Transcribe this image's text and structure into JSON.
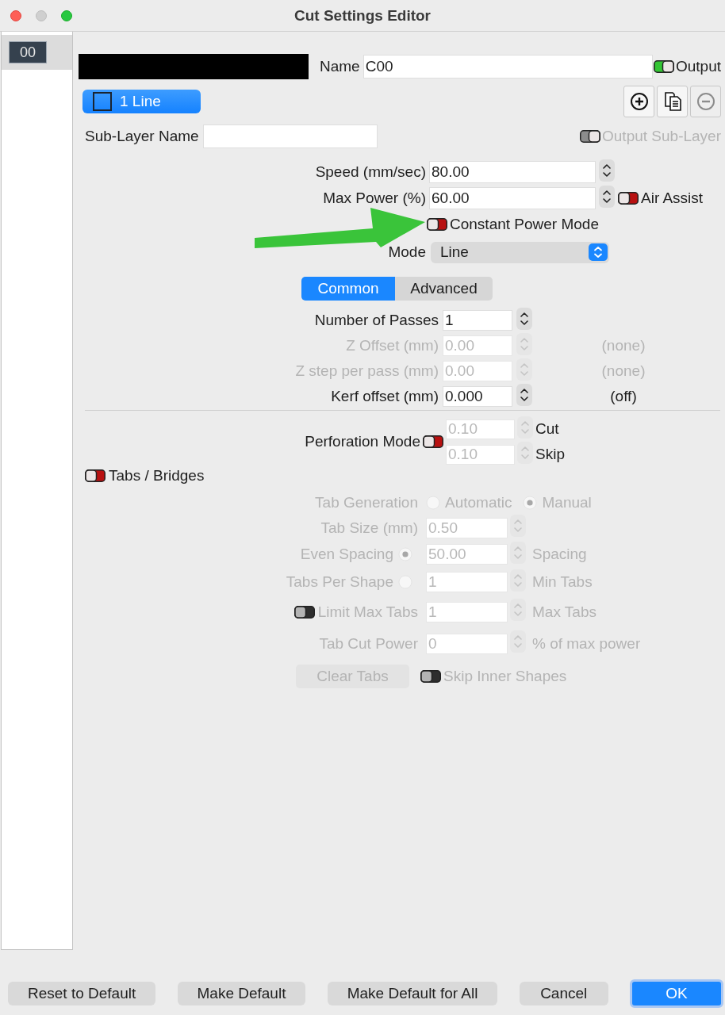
{
  "window": {
    "title": "Cut Settings Editor"
  },
  "layer_list": [
    {
      "label": "00",
      "selected": true
    }
  ],
  "name_row": {
    "label": "Name",
    "value": "C00",
    "output": {
      "label": "Output",
      "on": true,
      "disabled": false
    }
  },
  "sub_layers": [
    {
      "label": "1 Line",
      "selected": true
    }
  ],
  "sub_layer_actions": [
    {
      "kind": "add",
      "disabled": false
    },
    {
      "kind": "copy",
      "disabled": false
    },
    {
      "kind": "remove",
      "disabled": true
    }
  ],
  "sub_layer_name": {
    "label": "Sub-Layer Name"
  },
  "output_sub_layer": {
    "label": "Output Sub-Layer",
    "on": true,
    "disabled": true
  },
  "power_fields": [
    {
      "label": "Speed (mm/sec)",
      "value": "80.00"
    },
    {
      "label": "Max Power (%)",
      "value": "60.00"
    }
  ],
  "air_assist": {
    "label": "Air Assist",
    "on": false,
    "disabled": false
  },
  "constant_power_mode": {
    "label": "Constant Power Mode",
    "on": false,
    "disabled": false
  },
  "mode": {
    "label": "Mode",
    "value": "Line"
  },
  "tabs": [
    {
      "label": "Common",
      "selected": true
    },
    {
      "label": "Advanced",
      "selected": false
    }
  ],
  "common_fields": [
    {
      "label": "Number of Passes",
      "value": "1",
      "disabled": false
    },
    {
      "label": "Z Offset (mm)",
      "value": "0.00",
      "disabled": true,
      "note": "(none)"
    },
    {
      "label": "Z step per pass (mm)",
      "value": "0.00",
      "disabled": true,
      "note": "(none)"
    },
    {
      "label": "Kerf offset (mm)",
      "value": "0.000",
      "disabled": false,
      "note": "(off)"
    }
  ],
  "perforation": {
    "label": "Perforation Mode",
    "on": false,
    "disabled": false,
    "fields": [
      {
        "value": "0.10",
        "label": "Cut",
        "disabled": true
      },
      {
        "value": "0.10",
        "label": "Skip",
        "disabled": true
      }
    ]
  },
  "tabs_bridges": {
    "label": "Tabs / Bridges",
    "on": false,
    "disabled": false
  },
  "tab_generation": {
    "label": "Tab Generation",
    "disabled": true,
    "options": [
      {
        "label": "Automatic",
        "selected": false
      },
      {
        "label": "Manual",
        "selected": true
      }
    ]
  },
  "tab_fields": [
    {
      "kind": "field",
      "label": "Tab Size (mm)",
      "value": "0.50",
      "disabled": true
    },
    {
      "kind": "radio",
      "label": "Even Spacing",
      "selected": true,
      "value": "50.00",
      "suffix": "Spacing",
      "disabled": true
    },
    {
      "kind": "radio",
      "label": "Tabs Per Shape",
      "selected": false,
      "value": "1",
      "suffix": "Min Tabs",
      "disabled": true
    },
    {
      "kind": "toggle",
      "label": "Limit Max Tabs",
      "on": false,
      "value": "1",
      "suffix": "Max Tabs",
      "disabled": true
    },
    {
      "kind": "field",
      "label": "Tab Cut Power",
      "value": "0",
      "suffix": "% of max power",
      "disabled": true
    }
  ],
  "clear_tabs": {
    "label": "Clear Tabs",
    "disabled": true
  },
  "skip_inner_shapes": {
    "label": "Skip Inner Shapes",
    "on": false,
    "disabled": true
  },
  "buttons": [
    {
      "label": "Reset to Default",
      "kind": "normal"
    },
    {
      "label": "Make Default",
      "kind": "normal"
    },
    {
      "label": "Make Default for All",
      "kind": "normal"
    },
    {
      "label": "Cancel",
      "kind": "normal"
    },
    {
      "label": "OK",
      "kind": "default"
    }
  ]
}
